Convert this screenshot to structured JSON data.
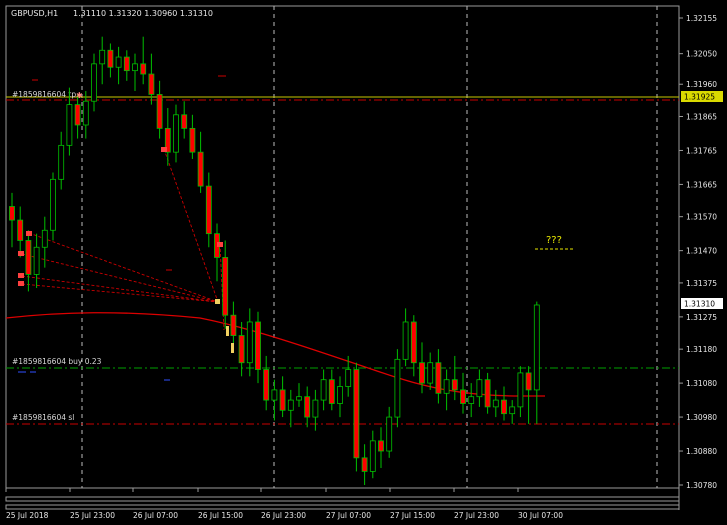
{
  "chart_header": {
    "symbol_tf": "GBPUSD,H1",
    "ohlc": "1.31110 1.31320 1.30960 1.31310"
  },
  "price_scale": {
    "labels": [
      "1.32155",
      "1.32050",
      "1.31960",
      "1.31865",
      "1.31765",
      "1.31665",
      "1.31570",
      "1.31470",
      "1.31375",
      "1.31275",
      "1.31180",
      "1.31080",
      "1.30980",
      "1.30880",
      "1.30780"
    ],
    "current_price": "1.31310",
    "marked_level": "1.31925"
  },
  "time_scale": {
    "labels": [
      "25 Jul 2018",
      "25 Jul 23:00",
      "26 Jul 07:00",
      "26 Jul 15:00",
      "26 Jul 23:00",
      "27 Jul 07:00",
      "27 Jul 15:00",
      "27 Jul 23:00",
      "30 Jul 07:00"
    ]
  },
  "order_lines": {
    "top_line_label": "#1859816604 tp",
    "entry_label": "#1859816604 buy 0.23",
    "sl_label": "#1859816604 sl"
  },
  "annotation": {
    "text": "???"
  },
  "colors": {
    "background": "#000000",
    "bull_body": "#000000",
    "bull_outline": "#00c000",
    "bear_body": "#ff0000",
    "wick": "#00c000",
    "moving_average": "#dd0000",
    "marked_line": "#c8c800",
    "entry_line": "#00a000",
    "sl_line": "#c80000",
    "annotation": "#e8e800"
  },
  "chart_data": {
    "type": "candlestick",
    "symbol": "GBPUSD",
    "timeframe": "H1",
    "ohlc": [
      [
        1.316,
        1.3164,
        1.3148,
        1.3156
      ],
      [
        1.3156,
        1.316,
        1.3145,
        1.315
      ],
      [
        1.315,
        1.3153,
        1.3135,
        1.314
      ],
      [
        1.314,
        1.3152,
        1.3136,
        1.3148
      ],
      [
        1.3148,
        1.3157,
        1.3142,
        1.3153
      ],
      [
        1.3153,
        1.317,
        1.315,
        1.3168
      ],
      [
        1.3168,
        1.3182,
        1.3165,
        1.3178
      ],
      [
        1.3178,
        1.3195,
        1.3175,
        1.319
      ],
      [
        1.319,
        1.3193,
        1.318,
        1.3184
      ],
      [
        1.3184,
        1.3194,
        1.318,
        1.3191
      ],
      [
        1.3191,
        1.3205,
        1.3188,
        1.3202
      ],
      [
        1.3202,
        1.321,
        1.3196,
        1.3206
      ],
      [
        1.3206,
        1.3208,
        1.3198,
        1.3201
      ],
      [
        1.3201,
        1.3207,
        1.3196,
        1.3204
      ],
      [
        1.3204,
        1.3206,
        1.3197,
        1.32
      ],
      [
        1.32,
        1.3205,
        1.3194,
        1.3202
      ],
      [
        1.3202,
        1.321,
        1.3196,
        1.3199
      ],
      [
        1.3199,
        1.3205,
        1.319,
        1.3193
      ],
      [
        1.3193,
        1.3197,
        1.318,
        1.3183
      ],
      [
        1.3183,
        1.3189,
        1.3172,
        1.3176
      ],
      [
        1.3176,
        1.319,
        1.3173,
        1.3187
      ],
      [
        1.3187,
        1.3191,
        1.318,
        1.3183
      ],
      [
        1.3183,
        1.3187,
        1.3174,
        1.3176
      ],
      [
        1.3176,
        1.3182,
        1.3164,
        1.3166
      ],
      [
        1.3166,
        1.317,
        1.3148,
        1.3152
      ],
      [
        1.3152,
        1.3155,
        1.3138,
        1.3145
      ],
      [
        1.3145,
        1.315,
        1.3124,
        1.3128
      ],
      [
        1.3128,
        1.3132,
        1.3118,
        1.3122
      ],
      [
        1.3122,
        1.3126,
        1.311,
        1.3114
      ],
      [
        1.3114,
        1.313,
        1.311,
        1.3126
      ],
      [
        1.3126,
        1.3129,
        1.3108,
        1.3112
      ],
      [
        1.3112,
        1.3116,
        1.31,
        1.3103
      ],
      [
        1.3103,
        1.3109,
        1.3097,
        1.3106
      ],
      [
        1.3106,
        1.311,
        1.3098,
        1.31
      ],
      [
        1.31,
        1.3106,
        1.3095,
        1.3103
      ],
      [
        1.3103,
        1.3108,
        1.3101,
        1.3104
      ],
      [
        1.3104,
        1.3107,
        1.3095,
        1.3098
      ],
      [
        1.3098,
        1.3106,
        1.3094,
        1.3103
      ],
      [
        1.3103,
        1.3112,
        1.31,
        1.3109
      ],
      [
        1.3109,
        1.3112,
        1.31,
        1.3102
      ],
      [
        1.3102,
        1.311,
        1.3098,
        1.3107
      ],
      [
        1.3107,
        1.3116,
        1.3104,
        1.3112
      ],
      [
        1.3112,
        1.3114,
        1.3082,
        1.3086
      ],
      [
        1.3086,
        1.309,
        1.3078,
        1.3082
      ],
      [
        1.3082,
        1.3094,
        1.308,
        1.3091
      ],
      [
        1.3091,
        1.3095,
        1.3083,
        1.3088
      ],
      [
        1.3088,
        1.3101,
        1.3086,
        1.3098
      ],
      [
        1.3098,
        1.3118,
        1.3095,
        1.3115
      ],
      [
        1.3115,
        1.313,
        1.3113,
        1.3126
      ],
      [
        1.3126,
        1.3128,
        1.311,
        1.3114
      ],
      [
        1.3114,
        1.312,
        1.3105,
        1.3108
      ],
      [
        1.3108,
        1.3117,
        1.3106,
        1.3114
      ],
      [
        1.3114,
        1.3118,
        1.3102,
        1.3105
      ],
      [
        1.3105,
        1.3112,
        1.31,
        1.3109
      ],
      [
        1.3109,
        1.3116,
        1.3103,
        1.3106
      ],
      [
        1.3106,
        1.3111,
        1.3099,
        1.3102
      ],
      [
        1.3102,
        1.3108,
        1.3098,
        1.3104
      ],
      [
        1.3104,
        1.3112,
        1.3101,
        1.3109
      ],
      [
        1.3109,
        1.3111,
        1.3099,
        1.3101
      ],
      [
        1.3101,
        1.3106,
        1.3098,
        1.3103
      ],
      [
        1.3103,
        1.3107,
        1.3097,
        1.3099
      ],
      [
        1.3099,
        1.3103,
        1.3096,
        1.3101
      ],
      [
        1.3101,
        1.3113,
        1.3098,
        1.3111
      ],
      [
        1.3111,
        1.3113,
        1.3096,
        1.3106
      ],
      [
        1.3106,
        1.3132,
        1.3096,
        1.3131
      ]
    ]
  }
}
